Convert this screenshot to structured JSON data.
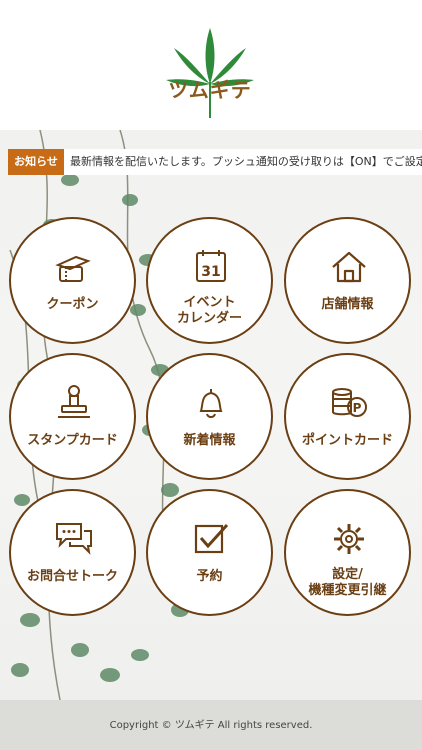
{
  "header": {
    "logo_text": "ツムギテ"
  },
  "notice": {
    "badge": "お知らせ",
    "text": "最新情報を配信いたします。プッシュ通知の受け取りは【ON】でご設定お願"
  },
  "menu": [
    {
      "label": "クーポン",
      "icon": "coupon-ticket-icon"
    },
    {
      "label": "イベント\nカレンダー",
      "line1": "イベント",
      "line2": "カレンダー",
      "icon": "calendar-icon",
      "calendar_day": "31"
    },
    {
      "label": "店舗情報",
      "icon": "house-icon"
    },
    {
      "label": "スタンプカード",
      "icon": "stamp-icon"
    },
    {
      "label": "新着情報",
      "icon": "bell-icon"
    },
    {
      "label": "ポイントカード",
      "icon": "coins-icon",
      "point_glyph": "P"
    },
    {
      "label": "お問合せトーク",
      "icon": "chat-bubble-icon"
    },
    {
      "label": "予約",
      "icon": "checkbox-icon"
    },
    {
      "label": "設定/\n機種変更引継",
      "line1": "設定/",
      "line2": "機種変更引継",
      "icon": "gear-icon"
    }
  ],
  "footer": {
    "copyright": "Copyright © ツムギテ All rights reserved."
  },
  "colors": {
    "brand_brown": "#6b3f14",
    "notice_orange": "#c86b17",
    "leaf_green": "#2f8a3a"
  }
}
